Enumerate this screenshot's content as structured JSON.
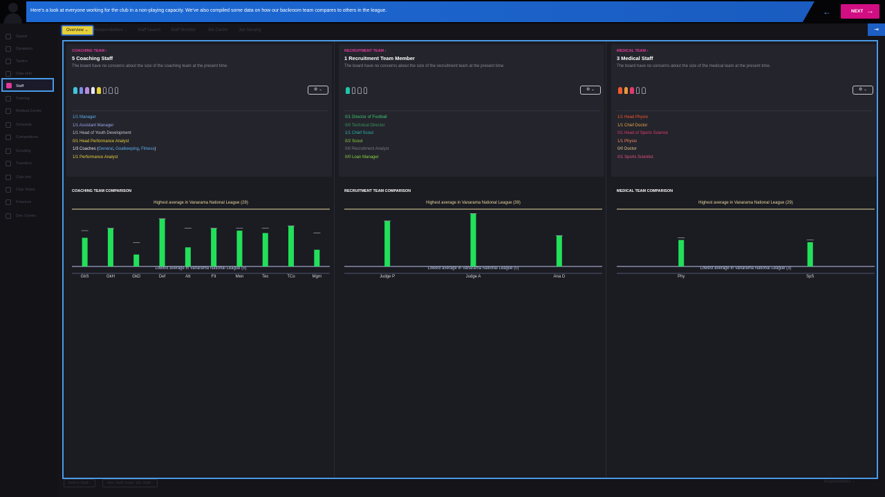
{
  "banner": {
    "message": "Here's a look at everyone working for the club in a non-playing capacity. We've also compiled some data on how our backroom team compares to others in the league.",
    "prev_icon": "arrow-left-icon",
    "next_label": "NEXT",
    "next_icon": "arrow-right-icon"
  },
  "sidebar": {
    "items": [
      {
        "label": "Squad",
        "icon": "squad-icon"
      },
      {
        "label": "Dynamics",
        "icon": "dynamics-icon"
      },
      {
        "label": "Tactics",
        "icon": "tactics-icon"
      },
      {
        "label": "Data Hub",
        "icon": "data-hub-icon"
      },
      {
        "label": "Staff",
        "icon": "staff-icon"
      },
      {
        "label": "Training",
        "icon": "training-icon"
      },
      {
        "label": "Medical Centre",
        "icon": "medical-icon"
      },
      {
        "label": "Schedule",
        "icon": "schedule-icon"
      },
      {
        "label": "Competitions",
        "icon": "competitions-icon"
      },
      {
        "label": "Scouting",
        "icon": "scouting-icon"
      },
      {
        "label": "Transfers",
        "icon": "transfers-icon"
      },
      {
        "label": "Club Info",
        "icon": "club-info-icon"
      },
      {
        "label": "Club Vision",
        "icon": "club-vision-icon"
      },
      {
        "label": "Finances",
        "icon": "finances-icon"
      },
      {
        "label": "Dev. Centre",
        "icon": "dev-centre-icon"
      }
    ],
    "active_index": 4
  },
  "tabs": [
    {
      "label": "Overview ⌄"
    },
    {
      "label": "Responsibilities ⌄"
    },
    {
      "label": "Staff Search"
    },
    {
      "label": "Staff Shortlist"
    },
    {
      "label": "Job Centre"
    },
    {
      "label": "Job Security"
    }
  ],
  "export_icon": "export-icon",
  "columns": [
    {
      "kicker": "COACHING TEAM ›",
      "title": "5 Coaching Staff",
      "desc": "The board have no concerns about the size of the coaching team at the present time.",
      "figures": [
        "#3ec6d8",
        "#7c8ee8",
        "#b88ae0",
        "#e8e8f0",
        "#e8d23a",
        null,
        null,
        null
      ],
      "filter_label": "⚙ ⌄",
      "roles": [
        {
          "text": "1/1 Manager",
          "color": "#5ab0ec"
        },
        {
          "text": "1/1 Assistant Manager",
          "color": "#9aa6e8"
        },
        {
          "text": "1/1 Head of Youth Development",
          "color": "#c8c8d0"
        },
        {
          "text": "0/1 Head Performance Analyst",
          "color": "#e8d23a"
        },
        {
          "text": "1/3 Coaches (",
          "color": "#e8e8f0",
          "extras": [
            "General",
            ", ",
            "Goalkeeping",
            ", ",
            "Fitness",
            ")"
          ]
        },
        {
          "text": "1/1 Performance Analyst",
          "color": "#e8d23a"
        }
      ],
      "comparison_title": "COACHING TEAM COMPARISON",
      "chart_data": {
        "type": "bar",
        "categories": [
          "GkS",
          "GkH",
          "GkD",
          "Def",
          "Att",
          "Fit",
          "Men",
          "Tec",
          "TCo",
          "Mgm"
        ],
        "values": [
          17,
          21,
          10,
          25,
          13,
          21,
          20,
          19,
          22,
          12
        ],
        "league_average": [
          20,
          21,
          15,
          25,
          21,
          21,
          21,
          21,
          22,
          19
        ],
        "highest_label": "Highest average in Vanarama National League (29)",
        "lowest_label": "Lowest average in Vanarama National League (5)",
        "highest": 29,
        "lowest": 5,
        "bar_color": "#22e05a"
      }
    },
    {
      "kicker": "RECRUITMENT TEAM ›",
      "title": "1 Recruitment Team Member",
      "desc": "The board have no concerns about the size of the recruitment team at the present time.",
      "figures": [
        "#1ec6a8",
        null,
        null,
        null
      ],
      "filter_label": "⚙ ⌄",
      "roles": [
        {
          "text": "0/1 Director of Football",
          "color": "#3ec86a"
        },
        {
          "text": "0/0 Technical Director",
          "color": "#3a9a5a"
        },
        {
          "text": "1/1 Chief Scout",
          "color": "#2ab8a8"
        },
        {
          "text": "0/2 Scout",
          "color": "#8ad83a"
        },
        {
          "text": "0/0 Recruitment Analyst",
          "color": "#7a7a86"
        },
        {
          "text": "0/0 Loan Manager",
          "color": "#8ad83a"
        }
      ],
      "comparison_title": "RECRUITMENT TEAM COMPARISON",
      "chart_data": {
        "type": "bar",
        "categories": [
          "Judge P",
          "Judge A",
          "Ana D"
        ],
        "values": [
          31,
          36,
          21
        ],
        "league_average": [
          31,
          36,
          21
        ],
        "highest_label": "Highest average in Vanarama National League (39)",
        "lowest_label": "Lowest average in Vanarama National League (0)",
        "highest": 39,
        "lowest": 0,
        "bar_color": "#22e05a"
      }
    },
    {
      "kicker": "MEDICAL TEAM ›",
      "title": "3 Medical Staff",
      "desc": "The board have no concerns about the size of the medical team at the present time.",
      "figures": [
        "#f05a2a",
        "#e89a3a",
        "#e23a6a",
        null,
        null
      ],
      "filter_label": "⚙ ⌄",
      "roles": [
        {
          "text": "1/1 Head Physio",
          "color": "#f05a2a"
        },
        {
          "text": "1/1 Chief Doctor",
          "color": "#e8a84a"
        },
        {
          "text": "0/1 Head of Sports Science",
          "color": "#e23a6a"
        },
        {
          "text": "1/1 Physio",
          "color": "#f08a5a"
        },
        {
          "text": "0/0 Doctor",
          "color": "#e8c88a"
        },
        {
          "text": "0/1 Sports Scientist",
          "color": "#e2527a"
        }
      ],
      "comparison_title": "MEDICAL TEAM COMPARISON",
      "chart_data": {
        "type": "bar",
        "categories": [
          "Phy",
          "SpS"
        ],
        "values": [
          15,
          14
        ],
        "league_average": [
          16,
          15
        ],
        "highest_label": "Highest average in Vanarama National League (29)",
        "lowest_label": "Lowest average in Vanarama National League (3)",
        "highest": 29,
        "lowest": 3,
        "bar_color": "#22e05a"
      }
    }
  ],
  "footer": {
    "buttons": [
      "Add to Staff ›",
      "Hire Staff Under 18s Staff ›"
    ],
    "responsibilities": "Responsibilities ⌄"
  }
}
